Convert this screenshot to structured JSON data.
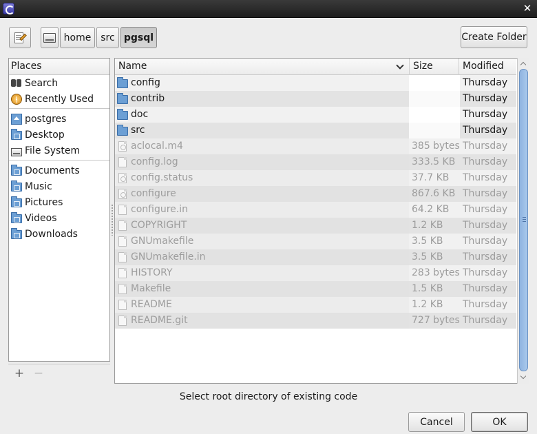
{
  "window": {
    "close_glyph": "✕"
  },
  "pathbar": {
    "segments": [
      "home",
      "src",
      "pgsql"
    ],
    "active": "pgsql",
    "create_folder": "Create Folder"
  },
  "places": {
    "header": "Places",
    "items": [
      {
        "label": "Search",
        "icon": "binoculars-icon"
      },
      {
        "label": "Recently Used",
        "icon": "recent-icon"
      },
      {
        "label": "postgres",
        "icon": "home-folder-icon"
      },
      {
        "label": "Desktop",
        "icon": "folder-icon"
      },
      {
        "label": "File System",
        "icon": "drive-icon"
      },
      {
        "label": "Documents",
        "icon": "folder-icon"
      },
      {
        "label": "Music",
        "icon": "folder-icon"
      },
      {
        "label": "Pictures",
        "icon": "folder-icon"
      },
      {
        "label": "Videos",
        "icon": "folder-icon"
      },
      {
        "label": "Downloads",
        "icon": "folder-icon"
      }
    ],
    "add_glyph": "+",
    "remove_glyph": "−"
  },
  "columns": {
    "name": "Name",
    "size": "Size",
    "modified": "Modified"
  },
  "files": [
    {
      "name": "config",
      "size": "",
      "modified": "Thursday",
      "type": "folder"
    },
    {
      "name": "contrib",
      "size": "",
      "modified": "Thursday",
      "type": "folder"
    },
    {
      "name": "doc",
      "size": "",
      "modified": "Thursday",
      "type": "folder"
    },
    {
      "name": "src",
      "size": "",
      "modified": "Thursday",
      "type": "folder"
    },
    {
      "name": "aclocal.m4",
      "size": "385 bytes",
      "modified": "Thursday",
      "type": "exec"
    },
    {
      "name": "config.log",
      "size": "333.5 KB",
      "modified": "Thursday",
      "type": "file"
    },
    {
      "name": "config.status",
      "size": "37.7 KB",
      "modified": "Thursday",
      "type": "exec"
    },
    {
      "name": "configure",
      "size": "867.6 KB",
      "modified": "Thursday",
      "type": "exec"
    },
    {
      "name": "configure.in",
      "size": "64.2 KB",
      "modified": "Thursday",
      "type": "file"
    },
    {
      "name": "COPYRIGHT",
      "size": "1.2 KB",
      "modified": "Thursday",
      "type": "file"
    },
    {
      "name": "GNUmakefile",
      "size": "3.5 KB",
      "modified": "Thursday",
      "type": "file"
    },
    {
      "name": "GNUmakefile.in",
      "size": "3.5 KB",
      "modified": "Thursday",
      "type": "file"
    },
    {
      "name": "HISTORY",
      "size": "283 bytes",
      "modified": "Thursday",
      "type": "file"
    },
    {
      "name": "Makefile",
      "size": "1.5 KB",
      "modified": "Thursday",
      "type": "file"
    },
    {
      "name": "README",
      "size": "1.2 KB",
      "modified": "Thursday",
      "type": "file"
    },
    {
      "name": "README.git",
      "size": "727 bytes",
      "modified": "Thursday",
      "type": "file"
    }
  ],
  "status_text": "Select root directory of existing code",
  "buttons": {
    "cancel": "Cancel",
    "ok": "OK"
  }
}
